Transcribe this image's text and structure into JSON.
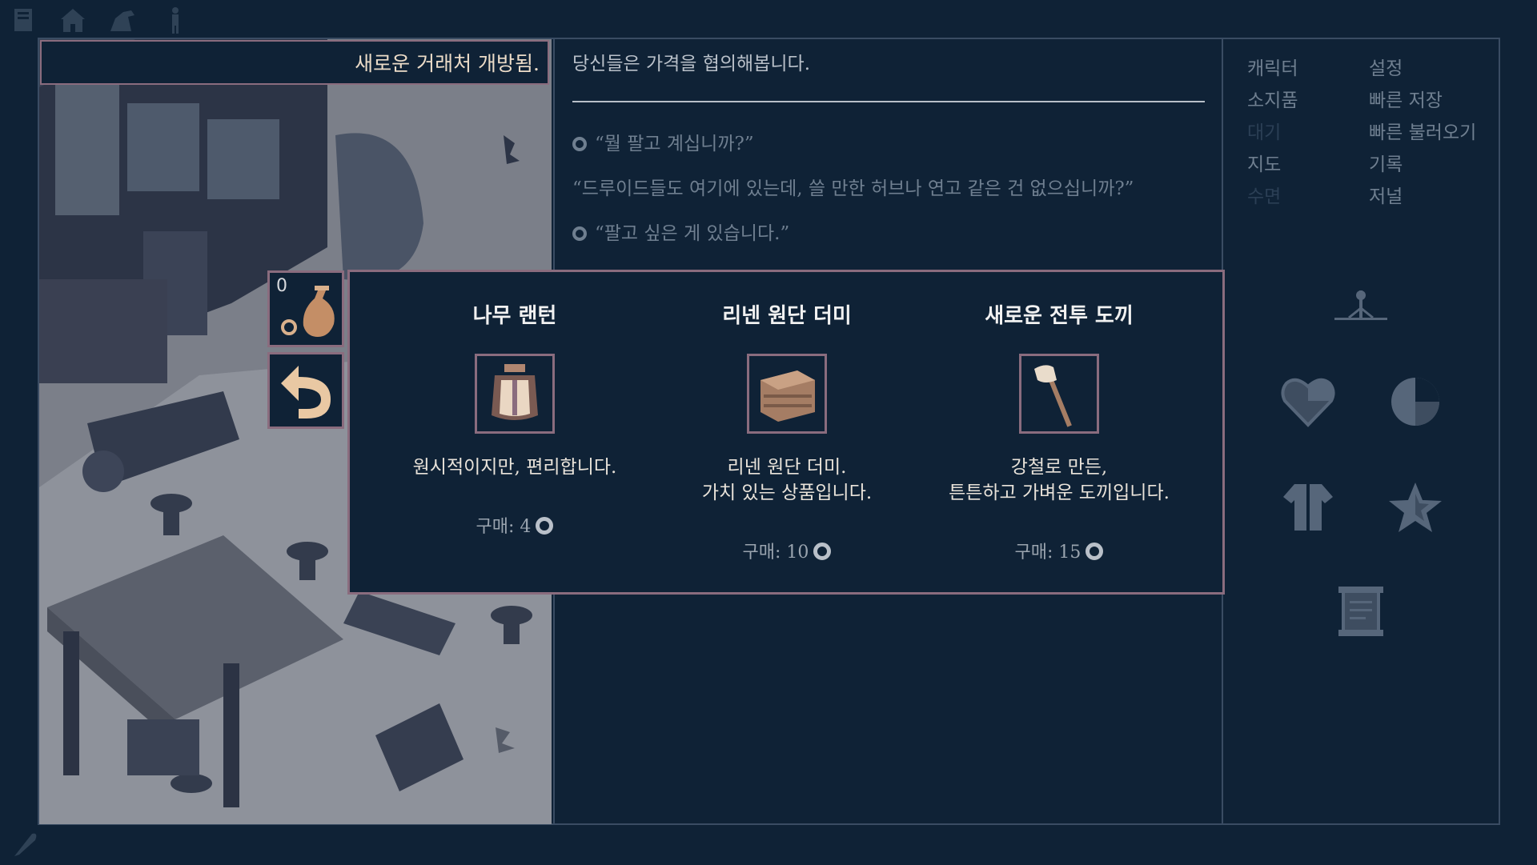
{
  "top_icons": [
    "journal-icon",
    "village-icon",
    "horse-icon",
    "person-icon"
  ],
  "notice": {
    "text": "새로운 거래처 개방됨."
  },
  "narration": {
    "intro": "당신들은 가격을 협의해봅니다.",
    "lines": [
      {
        "speaker_icon": true,
        "text": "“뭘 팔고 계십니까?”"
      },
      {
        "speaker_icon": false,
        "text": "“드루이드들도 여기에 있는데, 쓸 만한 허브나 연고 같은 건 없으십니까?”"
      },
      {
        "speaker_icon": true,
        "text": "“팔고 싶은 게 있습니다.”"
      }
    ]
  },
  "menu": {
    "left": [
      {
        "label": "캐릭터",
        "enabled": true
      },
      {
        "label": "소지품",
        "enabled": true
      },
      {
        "label": "대기",
        "enabled": false
      },
      {
        "label": "지도",
        "enabled": true
      },
      {
        "label": "수면",
        "enabled": false
      }
    ],
    "right": [
      {
        "label": "설정",
        "enabled": true
      },
      {
        "label": "빠른 저장",
        "enabled": true
      },
      {
        "label": "빠른 불러오기",
        "enabled": true
      },
      {
        "label": "기록",
        "enabled": true
      },
      {
        "label": "저널",
        "enabled": true
      }
    ]
  },
  "side_icons": [
    "compass-icon",
    "heart-icon",
    "pie-icon",
    "shirt-icon",
    "star-icon",
    "scroll-icon"
  ],
  "inventory": {
    "count": "0"
  },
  "trade": {
    "items": [
      {
        "name": "나무 랜턴",
        "icon": "lantern-icon",
        "desc": [
          "원시적이지만, 편리합니다."
        ],
        "price_label": "구매: 4"
      },
      {
        "name": "리넨 원단 더미",
        "icon": "linen-icon",
        "desc": [
          "리넨 원단 더미.",
          "가치 있는 상품입니다."
        ],
        "price_label": "구매: 10"
      },
      {
        "name": "새로운 전투 도끼",
        "icon": "axe-icon",
        "desc": [
          "강철로 만든,",
          "튼튼하고 가벼운 도끼입니다."
        ],
        "price_label": "구매: 15"
      }
    ]
  },
  "colors": {
    "background": "#0f2236",
    "border": "#8a6c7e",
    "text": "#c9cfd6",
    "muted": "#6f7f90"
  }
}
